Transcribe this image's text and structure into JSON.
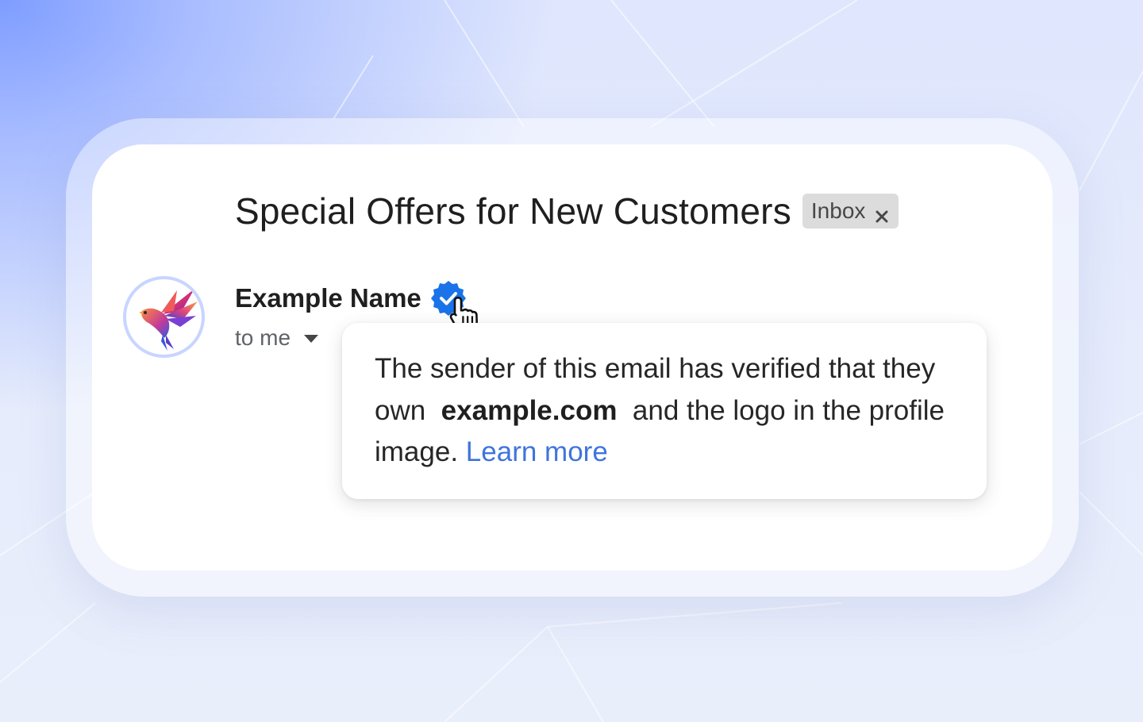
{
  "email": {
    "subject": "Special Offers for New Customers",
    "label_chip": {
      "text": "Inbox",
      "close_icon": "close-icon"
    },
    "sender": {
      "name": "Example Name",
      "badge_icon": "verified-check-icon",
      "avatar_icon": "bird-logo-icon"
    },
    "recipient": {
      "text": "to me",
      "expand_icon": "caret-down-icon"
    }
  },
  "tooltip": {
    "text_before": "The sender of this email has verified that they own",
    "domain": "example.com",
    "text_after": "and the logo in the profile image.",
    "link_text": "Learn more"
  },
  "colors": {
    "badge_blue": "#1a73e8",
    "link_blue": "#3f74db",
    "chip_gray": "#dcdcdc",
    "avatar_ring": "#c7d5ff"
  }
}
